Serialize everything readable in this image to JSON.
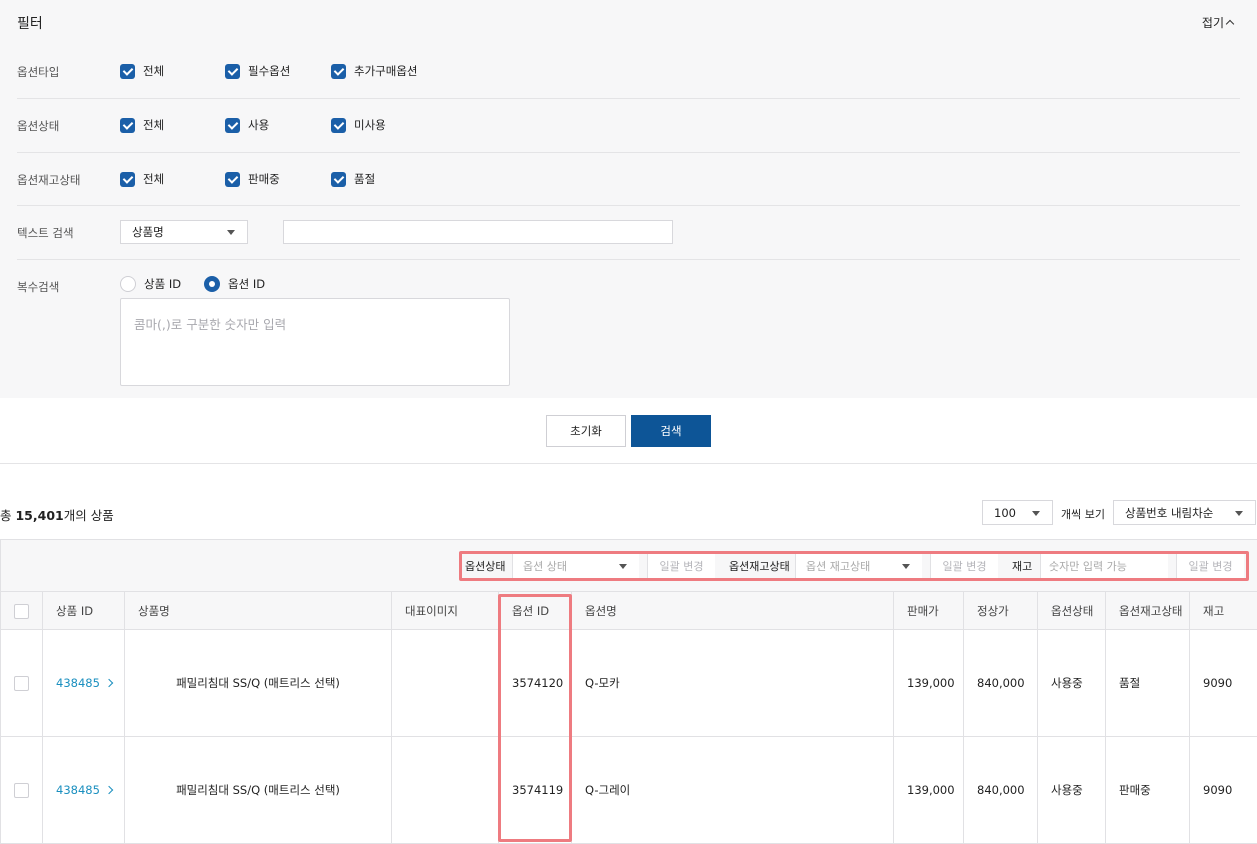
{
  "filter": {
    "title": "필터",
    "collapse_label": "접기",
    "option_type": {
      "label": "옵션타입",
      "options": [
        "전체",
        "필수옵션",
        "추가구매옵션"
      ]
    },
    "option_status": {
      "label": "옵션상태",
      "options": [
        "전체",
        "사용",
        "미사용"
      ]
    },
    "option_stock_status": {
      "label": "옵션재고상태",
      "options": [
        "전체",
        "판매중",
        "품절"
      ]
    },
    "text_search": {
      "label": "텍스트 검색",
      "select_value": "상품명",
      "input_value": ""
    },
    "multi_search": {
      "label": "복수검색",
      "radio_options": [
        "상품 ID",
        "옵션 ID"
      ],
      "selected": "옵션 ID",
      "textarea_placeholder": "콤마(,)로 구분한 숫자만 입력"
    }
  },
  "actions": {
    "reset_label": "초기화",
    "search_label": "검색"
  },
  "results": {
    "total_prefix": "총 ",
    "total_count": "15,401",
    "total_suffix": "개의 상품",
    "page_size": "100",
    "page_size_suffix": "개씩 보기",
    "sort": "상품번호 내림차순"
  },
  "toolbar": {
    "option_status_label": "옵션상태",
    "option_status_placeholder": "옵션 상태",
    "bulk_change_label": "일괄 변경",
    "stock_status_label": "옵션재고상태",
    "stock_status_placeholder": "옵션 재고상태",
    "stock_label": "재고",
    "stock_placeholder": "숫자만 입력 가능"
  },
  "table": {
    "columns": [
      "상품 ID",
      "상품명",
      "대표이미지",
      "옵션 ID",
      "옵션명",
      "판매가",
      "정상가",
      "옵션상태",
      "옵션재고상태",
      "재고"
    ],
    "rows": [
      {
        "product_id": "438485",
        "product_name": "패밀리침대 SS/Q (매트리스 선택)",
        "image": "",
        "option_id": "3574120",
        "option_name": "Q-모카",
        "price": "139,000",
        "list_price": "840,000",
        "status": "사용중",
        "stock_status": "품절",
        "stock": "9090"
      },
      {
        "product_id": "438485",
        "product_name": "패밀리침대 SS/Q (매트리스 선택)",
        "image": "",
        "option_id": "3574119",
        "option_name": "Q-그레이",
        "price": "139,000",
        "list_price": "840,000",
        "status": "사용중",
        "stock_status": "판매중",
        "stock": "9090"
      }
    ]
  },
  "colors": {
    "primary": "#0d5597",
    "checkbox": "#1b5fa8",
    "link": "#1a8fbf",
    "highlight": "#ee7b80"
  }
}
